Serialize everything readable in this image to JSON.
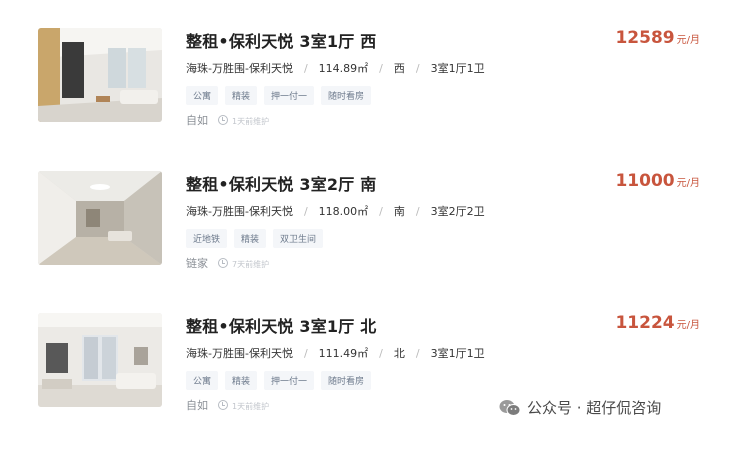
{
  "listings": [
    {
      "title": "整租•保利天悦 3室1厅 西",
      "price": "12589",
      "price_unit": "元/月",
      "district": "海珠-万胜围-保利天悦",
      "area": "114.89㎡",
      "orientation": "西",
      "layout": "3室1厅1卫",
      "tags": [
        "公寓",
        "精装",
        "押一付一",
        "随时看房"
      ],
      "agent": "自如",
      "updated": "1天前维护"
    },
    {
      "title": "整租•保利天悦 3室2厅 南",
      "price": "11000",
      "price_unit": "元/月",
      "district": "海珠-万胜围-保利天悦",
      "area": "118.00㎡",
      "orientation": "南",
      "layout": "3室2厅2卫",
      "tags": [
        "近地铁",
        "精装",
        "双卫生间"
      ],
      "agent": "链家",
      "updated": "7天前维护"
    },
    {
      "title": "整租•保利天悦 3室1厅 北",
      "price": "11224",
      "price_unit": "元/月",
      "district": "海珠-万胜围-保利天悦",
      "area": "111.49㎡",
      "orientation": "北",
      "layout": "3室1厅1卫",
      "tags": [
        "公寓",
        "精装",
        "押一付一",
        "随时看房"
      ],
      "agent": "自如",
      "updated": "1天前维护"
    }
  ],
  "watermark": "公众号 · 超仔侃咨询",
  "colors": {
    "price": "#c8553d",
    "tag_bg": "#f4f6f9",
    "tag_text": "#6d7a8c"
  },
  "icons": [
    "clock-icon",
    "wechat-icon"
  ]
}
